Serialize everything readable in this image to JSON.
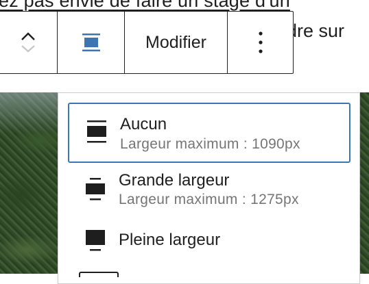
{
  "background": {
    "line1": "ez pas envie de faire un stage d'un",
    "line2": "dre sur"
  },
  "toolbar": {
    "move_up_icon": "chevron-up-icon",
    "move_down_icon": "chevron-down-icon",
    "align_icon": "align-none-icon",
    "modify_label": "Modifier",
    "more_icon": "more-vertical-icon",
    "accent": "#3c74b4"
  },
  "dropdown": {
    "options": [
      {
        "title": "Aucun",
        "subtitle": "Largeur maximum : 1090px",
        "icon": "align-none-icon",
        "selected": true
      },
      {
        "title": "Grande largeur",
        "subtitle": "Largeur maximum : 1275px",
        "icon": "align-wide-icon",
        "selected": false
      },
      {
        "title": "Pleine largeur",
        "subtitle": "",
        "icon": "align-full-icon",
        "selected": false
      }
    ],
    "selected_border_color": "#3c74b4"
  }
}
